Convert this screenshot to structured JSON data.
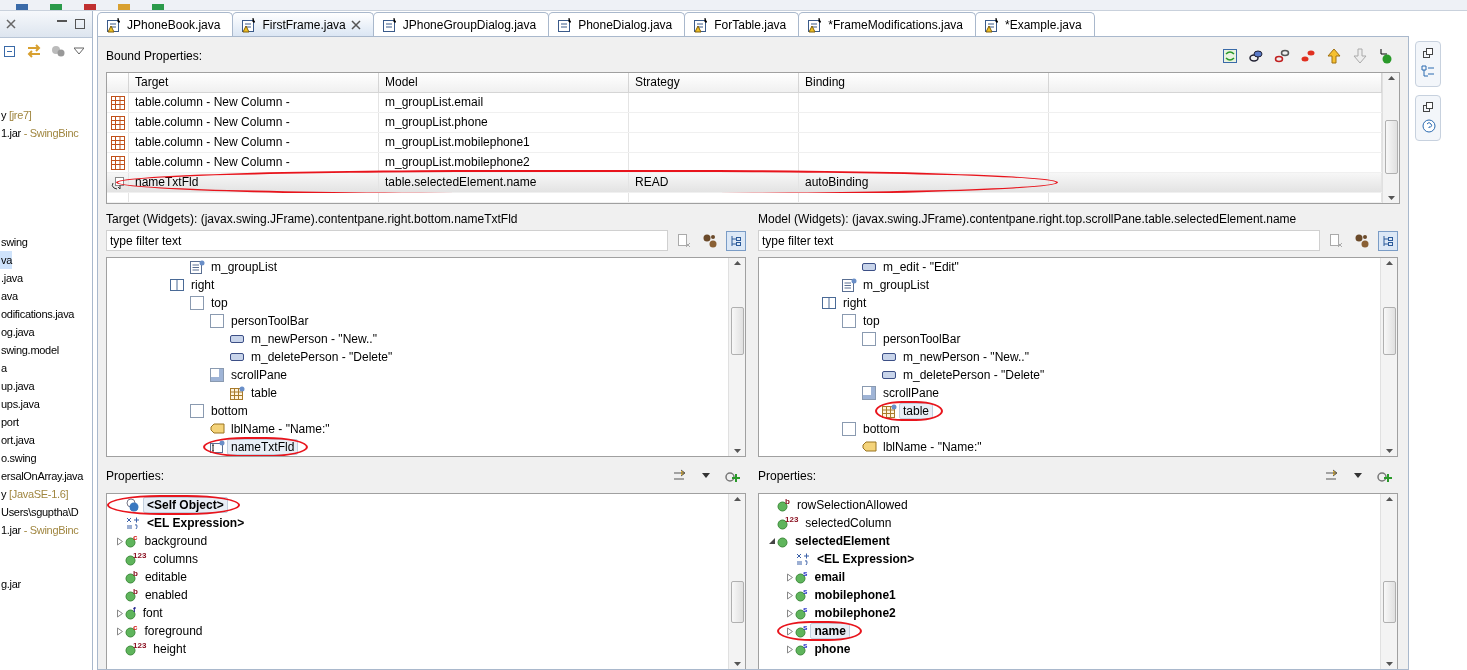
{
  "sidebar": {
    "groups": [
      [
        {
          "text": "y",
          "note": "[jre7]",
          "selected": false
        },
        {
          "text": "1.jar",
          "note": "- SwingBinc",
          "selected": false
        }
      ],
      [
        {
          "text": "swing",
          "selected": false
        },
        {
          "text": "va",
          "selected": true
        },
        {
          "text": ".java",
          "selected": false
        },
        {
          "text": "ava",
          "selected": false
        },
        {
          "text": "odifications.java",
          "selected": false
        },
        {
          "text": "og.java",
          "selected": false
        },
        {
          "text": "swing.model",
          "selected": false
        },
        {
          "text": "a",
          "selected": false
        },
        {
          "text": "up.java",
          "selected": false
        },
        {
          "text": "ups.java",
          "selected": false
        },
        {
          "text": "port",
          "selected": false
        },
        {
          "text": "ort.java",
          "selected": false
        },
        {
          "text": "o.swing",
          "selected": false
        },
        {
          "text": "ersalOnArray.java",
          "selected": false
        },
        {
          "text": "y",
          "note": "[JavaSE-1.6]",
          "selected": false
        },
        {
          "text": "Users\\sguptha\\D",
          "selected": false
        },
        {
          "text": "1.jar",
          "note": "- SwingBinc",
          "selected": false
        }
      ],
      [
        {
          "text": "g.jar",
          "selected": false
        }
      ]
    ]
  },
  "tabs": [
    {
      "label": "JPhoneBook.java",
      "selected": false,
      "warning": true
    },
    {
      "label": "FirstFrame.java",
      "selected": true,
      "warning": true
    },
    {
      "label": "JPhoneGroupDialog.java",
      "selected": false,
      "warning": false
    },
    {
      "label": "PhoneDialog.java",
      "selected": false,
      "warning": false
    },
    {
      "label": "ForTable.java",
      "selected": false,
      "warning": true
    },
    {
      "label": "*FrameModifications.java",
      "selected": false,
      "warning": true
    },
    {
      "label": "*Example.java",
      "selected": false,
      "warning": true
    }
  ],
  "bound_properties": {
    "title": "Bound Properties:",
    "columns": [
      "Target",
      "Model",
      "Strategy",
      "Binding"
    ],
    "rows": [
      {
        "kind": "column",
        "target": "table.column - New Column -",
        "model": "m_groupList.email",
        "selected": false,
        "circled": false
      },
      {
        "kind": "column",
        "target": "table.column - New Column -",
        "model": "m_groupList.phone",
        "selected": false,
        "circled": false
      },
      {
        "kind": "column",
        "target": "table.column - New Column -",
        "model": "m_groupList.mobilephone1",
        "selected": false,
        "circled": false
      },
      {
        "kind": "column",
        "target": "table.column - New Column -",
        "model": "m_groupList.mobilephone2",
        "selected": false,
        "circled": false
      },
      {
        "kind": "binding",
        "target": "nameTxtFld",
        "model": "table.selectedElement.name",
        "strategy": "READ",
        "binding": "autoBinding",
        "selected": true,
        "circled": true
      }
    ]
  },
  "target_pane": {
    "path": "Target (Widgets): (javax.swing.JFrame).contentpane.right.bottom.nameTxtFld",
    "filter": {
      "placeholder": "type filter text"
    },
    "tree": [
      {
        "children": [
          {
            "label": "m_groupList",
            "kind": "list",
            "selected": false,
            "circled": false
          }
        ]
      },
      {
        "label": "right",
        "kind": "split",
        "selected": false,
        "circled": false,
        "children": [
          {
            "label": "top",
            "kind": "panel",
            "selected": false,
            "circled": false,
            "children": [
              {
                "label": "personToolBar",
                "kind": "panel",
                "selected": false,
                "circled": false,
                "children": [
                  {
                    "label": "m_newPerson - \"New..\"",
                    "kind": "button",
                    "selected": false,
                    "circled": false
                  },
                  {
                    "label": "m_deletePerson - \"Delete\"",
                    "kind": "button",
                    "selected": false,
                    "circled": false
                  }
                ]
              },
              {
                "label": "scrollPane",
                "kind": "scroll",
                "selected": false,
                "circled": false,
                "children": [
                  {
                    "label": "table",
                    "kind": "table",
                    "selected": false,
                    "circled": false
                  }
                ]
              }
            ]
          },
          {
            "label": "bottom",
            "kind": "panel",
            "selected": false,
            "circled": false,
            "children": [
              {
                "label": "lblName - \"Name:\"",
                "kind": "label",
                "selected": false,
                "circled": false
              },
              {
                "label": "nameTxtFld",
                "kind": "textfield",
                "selected": true,
                "circled": true
              }
            ]
          }
        ]
      }
    ],
    "properties_title": "Properties:",
    "properties": [
      {
        "label": "<Self Object>",
        "kind": "self",
        "bold": true,
        "selected": true,
        "circled": true
      },
      {
        "label": "<EL Expression>",
        "kind": "expression",
        "bold": true,
        "selected": false,
        "circled": false
      },
      {
        "label": "background",
        "kind": "property",
        "type": "c",
        "bold": false,
        "expanded": false,
        "selected": false,
        "circled": false
      },
      {
        "label": "columns",
        "kind": "property",
        "type": "123",
        "bold": false,
        "selected": false,
        "circled": false
      },
      {
        "label": "editable",
        "kind": "property",
        "type": "b",
        "bold": false,
        "selected": false,
        "circled": false
      },
      {
        "label": "enabled",
        "kind": "property",
        "type": "b",
        "bold": false,
        "selected": false,
        "circled": false
      },
      {
        "label": "font",
        "kind": "property",
        "type": "f",
        "bold": false,
        "expanded": false,
        "selected": false,
        "circled": false
      },
      {
        "label": "foreground",
        "kind": "property",
        "type": "c",
        "bold": false,
        "expanded": false,
        "selected": false,
        "circled": false
      },
      {
        "label": "height",
        "kind": "property",
        "type": "123",
        "bold": false,
        "selected": false,
        "circled": false
      }
    ]
  },
  "model_pane": {
    "path": "Model (Widgets): (javax.swing.JFrame).contentpane.right.top.scrollPane.table.selectedElement.name",
    "filter": {
      "placeholder": "type filter text"
    },
    "tree": [
      {
        "children": [
          {
            "children": [
              {
                "label": "m_edit - \"Edit\"",
                "kind": "button",
                "selected": false,
                "circled": false
              }
            ]
          },
          {
            "label": "m_groupList",
            "kind": "list",
            "selected": false,
            "circled": false
          }
        ]
      },
      {
        "label": "right",
        "kind": "split",
        "selected": false,
        "circled": false,
        "children": [
          {
            "label": "top",
            "kind": "panel",
            "selected": false,
            "circled": false,
            "children": [
              {
                "label": "personToolBar",
                "kind": "panel",
                "selected": false,
                "circled": false,
                "children": [
                  {
                    "label": "m_newPerson - \"New..\"",
                    "kind": "button",
                    "selected": false,
                    "circled": false
                  },
                  {
                    "label": "m_deletePerson - \"Delete\"",
                    "kind": "button",
                    "selected": false,
                    "circled": false
                  }
                ]
              },
              {
                "label": "scrollPane",
                "kind": "scroll",
                "selected": false,
                "circled": false,
                "children": [
                  {
                    "label": "table",
                    "kind": "table",
                    "selected": true,
                    "circled": true
                  }
                ]
              }
            ]
          },
          {
            "label": "bottom",
            "kind": "panel",
            "selected": false,
            "circled": false,
            "children": [
              {
                "label": "lblName - \"Name:\"",
                "kind": "label",
                "selected": false,
                "circled": false
              }
            ]
          }
        ]
      }
    ],
    "properties_title": "Properties:",
    "properties": [
      {
        "label": "rowSelectionAllowed",
        "kind": "property",
        "type": "b",
        "bold": false,
        "selected": false,
        "circled": false
      },
      {
        "label": "selectedColumn",
        "kind": "property",
        "type": "123",
        "bold": false,
        "selected": false,
        "circled": false
      },
      {
        "label": "selectedElement",
        "kind": "property",
        "bold": true,
        "expanded": true,
        "selected": false,
        "circled": false,
        "children": [
          {
            "label": "<EL Expression>",
            "kind": "expression",
            "bold": true,
            "selected": false,
            "circled": false
          },
          {
            "label": "email",
            "kind": "property",
            "type": "s",
            "bold": true,
            "expanded": false,
            "selected": false,
            "circled": false
          },
          {
            "label": "mobilephone1",
            "kind": "property",
            "type": "s",
            "bold": true,
            "expanded": false,
            "selected": false,
            "circled": false
          },
          {
            "label": "mobilephone2",
            "kind": "property",
            "type": "s",
            "bold": true,
            "expanded": false,
            "selected": false,
            "circled": false
          },
          {
            "label": "name",
            "kind": "property",
            "type": "s",
            "bold": true,
            "expanded": false,
            "selected": true,
            "circled": true
          },
          {
            "label": "phone",
            "kind": "property",
            "type": "s",
            "bold": true,
            "expanded": false,
            "selected": false,
            "circled": false
          }
        ]
      }
    ]
  }
}
